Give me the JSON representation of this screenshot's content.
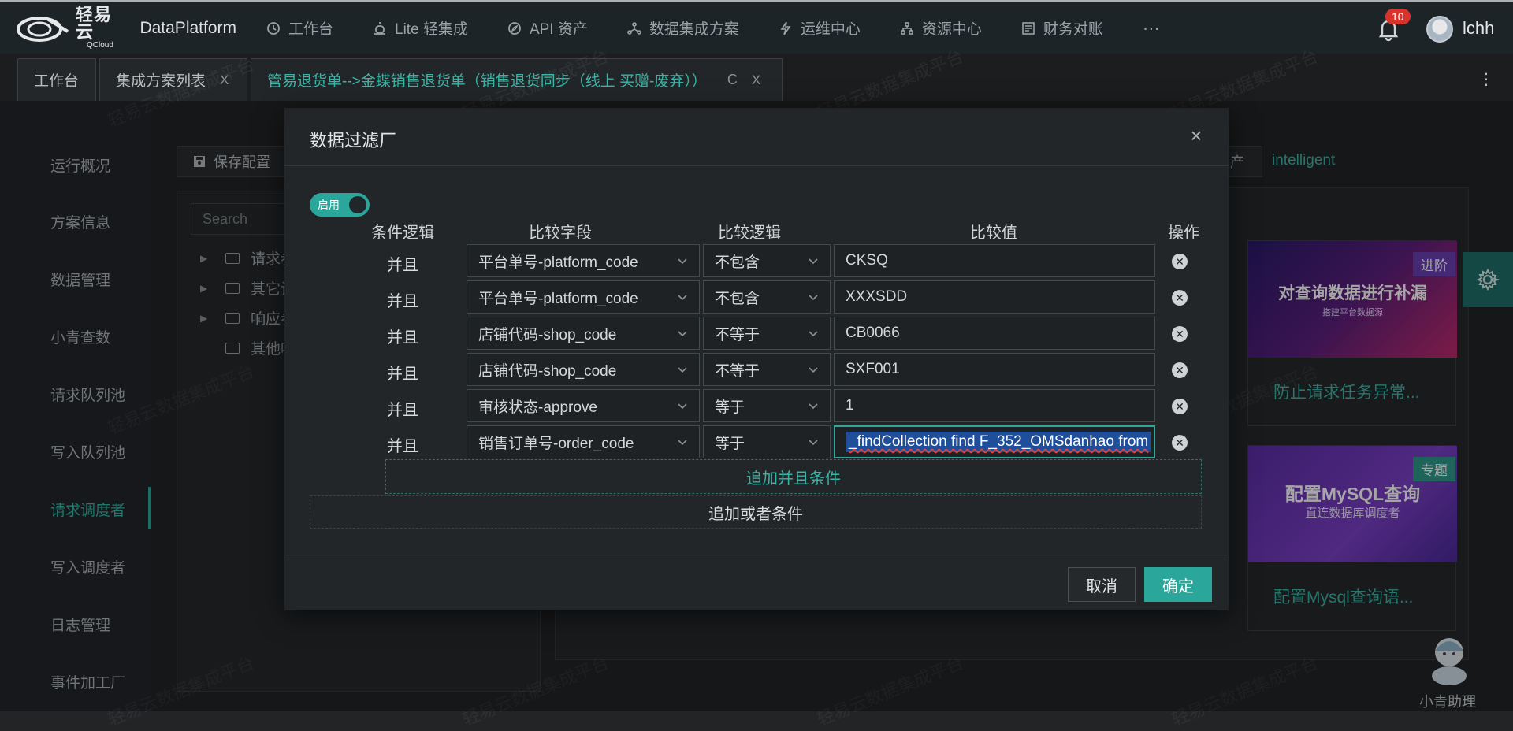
{
  "app": {
    "logo_cn": "轻易云",
    "logo_en": "QCloud",
    "product": "DataPlatform"
  },
  "nav": {
    "items": [
      {
        "label": "工作台",
        "icon": "clock-icon"
      },
      {
        "label": "Lite 轻集成",
        "icon": "alarm-icon"
      },
      {
        "label": "API 资产",
        "icon": "compass-icon"
      },
      {
        "label": "数据集成方案",
        "icon": "network-icon"
      },
      {
        "label": "运维中心",
        "icon": "bolt-icon"
      },
      {
        "label": "资源中心",
        "icon": "sitemap-icon"
      },
      {
        "label": "财务对账",
        "icon": "ledger-icon"
      }
    ],
    "more": "···",
    "notification_count": "10",
    "username": "lchh"
  },
  "tabs": [
    {
      "label": "工作台"
    },
    {
      "label": "集成方案列表",
      "close": "X"
    },
    {
      "label": "管易退货单-->金蝶销售退货单（销售退货同步（线上 买赠-废弃））",
      "close": "X",
      "refresh": "C"
    }
  ],
  "tab_menu": "⋮",
  "sidebar": {
    "items": [
      "运行概况",
      "方案信息",
      "数据管理",
      "小青查数",
      "请求队列池",
      "写入队列池",
      "请求调度者",
      "写入调度者",
      "日志管理",
      "事件加工厂"
    ],
    "active_index": 6
  },
  "background": {
    "save_config": "保存配置",
    "search_placeholder": "Search",
    "tree": [
      "请求参",
      "其它设",
      "响应参",
      "其他吗"
    ],
    "asset_btn": "产",
    "intelligent": "intelligent",
    "cards": [
      {
        "tag": "进阶",
        "caption": "防止请求任务异常...",
        "banner_title": "对查询数据进行补漏",
        "banner_sub": "搭建平台数据源",
        "tag_color": "#6a3fb4"
      },
      {
        "tag": "专题",
        "caption": "配置Mysql查询语...",
        "banner_title": "配置MySQL查询",
        "banner_sub": "直连数据库调度者",
        "tag_color": "#2e9a8c"
      }
    ],
    "assistant_label": "小青助理",
    "watermark": "轻易云数据集成平台"
  },
  "modal": {
    "title": "数据过滤厂",
    "close": "×",
    "toggle_label": "启用",
    "headers": {
      "logic": "条件逻辑",
      "field": "比较字段",
      "op": "比较逻辑",
      "value": "比较值",
      "action": "操作"
    },
    "rows": [
      {
        "logic": "并且",
        "field": "平台单号-platform_code",
        "op": "不包含",
        "value": "CKSQ"
      },
      {
        "logic": "并且",
        "field": "平台单号-platform_code",
        "op": "不包含",
        "value": "XXXSDD"
      },
      {
        "logic": "并且",
        "field": "店铺代码-shop_code",
        "op": "不等于",
        "value": "CB0066"
      },
      {
        "logic": "并且",
        "field": "店铺代码-shop_code",
        "op": "不等于",
        "value": "SXF001"
      },
      {
        "logic": "并且",
        "field": "审核状态-approve",
        "op": "等于",
        "value": "1"
      },
      {
        "logic": "并且",
        "field": "销售订单号-order_code",
        "op": "等于",
        "value": "_findCollection find F_352_OMSdanhao from"
      }
    ],
    "add_and": "追加并且条件",
    "add_or": "追加或者条件",
    "cancel": "取消",
    "confirm": "确定"
  }
}
